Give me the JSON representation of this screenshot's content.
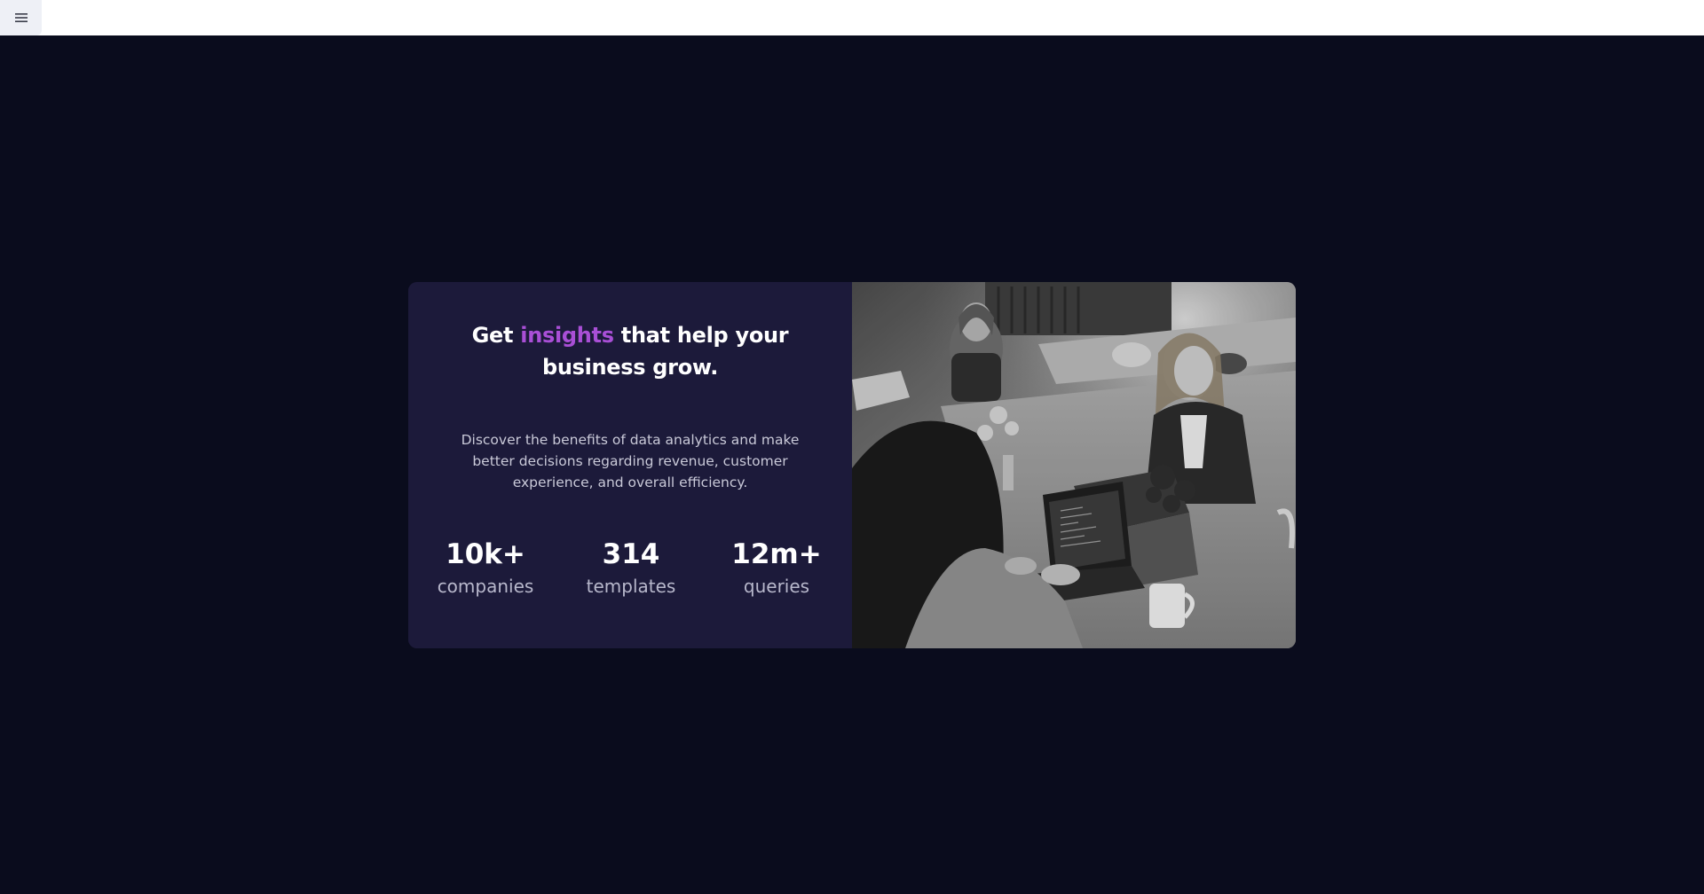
{
  "header": {
    "menu_icon": "hamburger-menu-icon"
  },
  "hero": {
    "title_before": "Get ",
    "title_accent": "insights",
    "title_after": " that help your business grow.",
    "description": "Discover the benefits of data analytics and make better decisions regarding revenue, customer experience, and overall efficiency.",
    "stats": [
      {
        "value": "10k+",
        "label": "companies"
      },
      {
        "value": "314",
        "label": "templates"
      },
      {
        "value": "12m+",
        "label": "queries"
      }
    ],
    "image_alt": "people working at desk"
  },
  "colors": {
    "page_background": "#0a0c1d",
    "card_background": "#1c1a3a",
    "accent": "#a94fd6",
    "text_primary": "#ffffff",
    "text_secondary": "#c9c9d8"
  }
}
